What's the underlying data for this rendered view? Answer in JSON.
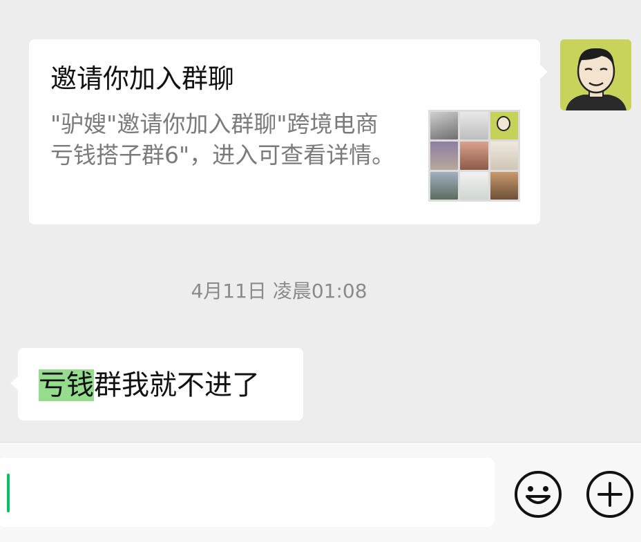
{
  "invite": {
    "title": "邀请你加入群聊",
    "description": "\"驴嫂\"邀请你加入群聊\"跨境电商亏钱搭子群6\"，进入可查看详情。"
  },
  "timestamp": "4月11日 凌晨01:08",
  "incoming_message": {
    "highlight": "亏钱",
    "rest": "群我就不进了"
  },
  "input": {
    "value": "",
    "emoji_icon": "emoji-icon",
    "plus_icon": "plus-icon"
  },
  "colors": {
    "background": "#ededed",
    "bubble": "#ffffff",
    "highlight": "#95dc8e",
    "caret": "#07c160"
  }
}
